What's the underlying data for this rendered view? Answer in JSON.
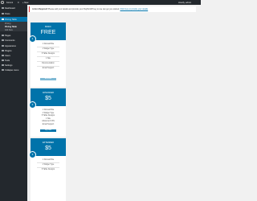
{
  "admin_bar": {
    "site_name": "Kommi",
    "comments_count": "0",
    "new_label": "+ New",
    "greeting": "Howdy, admin"
  },
  "sidebar": {
    "items": [
      {
        "label": "Dashboard",
        "icon": "dashboard-icon"
      },
      {
        "label": "Posts",
        "icon": "pin-icon"
      },
      {
        "label": "Pricing Table",
        "icon": "table-icon"
      },
      {
        "label": "Pages",
        "icon": "page-icon"
      },
      {
        "label": "Comments",
        "icon": "comment-icon"
      },
      {
        "label": "Appearance",
        "icon": "brush-icon"
      },
      {
        "label": "Plugins",
        "icon": "plugin-icon"
      },
      {
        "label": "Users",
        "icon": "user-icon"
      },
      {
        "label": "Tools",
        "icon": "wrench-icon"
      },
      {
        "label": "Settings",
        "icon": "settings-icon"
      },
      {
        "label": "Collapse menu",
        "icon": "collapse-icon"
      }
    ],
    "submenu": [
      "Pricing",
      "Pricing Table",
      "Add New"
    ]
  },
  "notice": {
    "bold": "Action Required!",
    "text": " Please add your details and provide your PayPal API key so we can get you started. ",
    "link": "Click here to provide your details"
  },
  "plans": [
    {
      "number": "1",
      "name": "BASIC",
      "price": "FREE",
      "features": [
        "1 Domain/Site",
        "1 Widget Type",
        "5 Table Designs",
        "1 Site",
        "Documentation",
        "Email Support"
      ],
      "button": "Activated"
    },
    {
      "number": "2",
      "name": "ADVANCED",
      "price": "$5",
      "features": [
        "1 Domain/Site",
        "1 Widget Type",
        "5 Table Designs",
        "1 Site",
        "Advanced CSS",
        "Email Support"
      ],
      "button": "Buy Now"
    },
    {
      "number": "3",
      "name": "EXTENDED",
      "price": "$5",
      "features": [
        "1 Domain/Site",
        "1 Widget Type",
        "5 Table Designs"
      ],
      "button": ""
    }
  ],
  "colors": {
    "accent": "#0073aa",
    "sidebar": "#23282d",
    "notice_border": "#dc3232"
  }
}
